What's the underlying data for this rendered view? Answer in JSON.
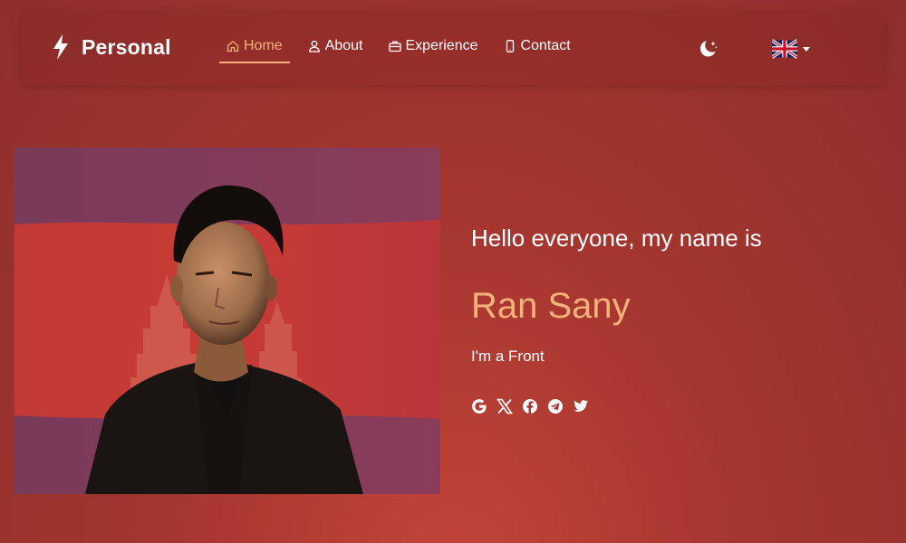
{
  "brand": {
    "name": "Personal",
    "icon": "lightning-bolt-icon"
  },
  "nav": {
    "items": [
      {
        "label": "Home",
        "icon": "home-icon",
        "active": true
      },
      {
        "label": "About",
        "icon": "user-icon",
        "active": false
      },
      {
        "label": "Experience",
        "icon": "briefcase-icon",
        "active": false
      },
      {
        "label": "Contact",
        "icon": "phone-icon",
        "active": false
      }
    ],
    "theme_toggle_icon": "moon-stars-icon",
    "language_icon": "uk-flag-icon"
  },
  "hero": {
    "image_icon": "profile-photo-cambodia-flag",
    "intro": "Hello everyone, my name is",
    "name": "Ran Sany",
    "role": "I'm a Front",
    "socials": [
      "google-icon",
      "x-icon",
      "facebook-icon",
      "telegram-icon",
      "twitter-icon"
    ]
  },
  "colors": {
    "accent": "#f4b27a",
    "background": "#a5362f",
    "text": "#ffffff"
  }
}
